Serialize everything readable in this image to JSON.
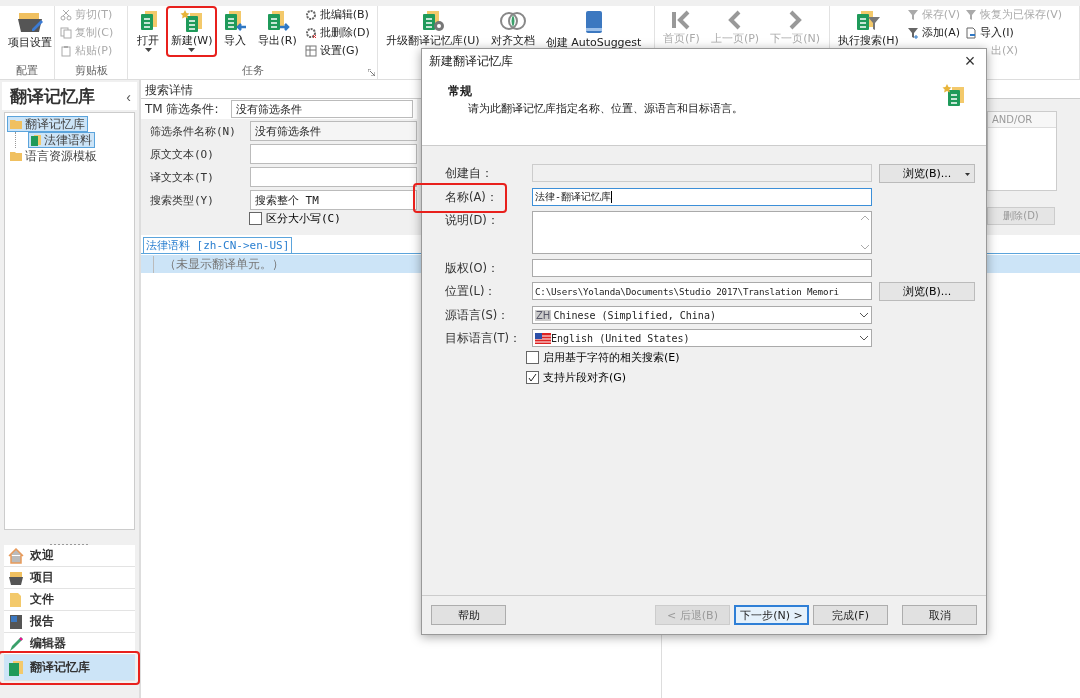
{
  "ribbon": {
    "groups": [
      {
        "label": "配置",
        "large": [
          {
            "label": "项目设置",
            "dropdown": false,
            "disabled": false,
            "highlighted": false
          }
        ]
      },
      {
        "label": "剪贴板",
        "columns": [
          [
            {
              "label": "剪切(T)",
              "disabled": true
            },
            {
              "label": "复制(C)",
              "disabled": true
            },
            {
              "label": "粘贴(P)",
              "disabled": true
            }
          ]
        ]
      },
      {
        "label": "任务",
        "launcher": true,
        "large": [
          {
            "label": "打开",
            "dropdown": true,
            "disabled": false,
            "highlighted": false
          },
          {
            "label": "新建(W)",
            "dropdown": true,
            "disabled": false,
            "highlighted": true
          },
          {
            "label": "导入",
            "dropdown": false,
            "disabled": false,
            "highlighted": false
          },
          {
            "label": "导出(R)",
            "dropdown": false,
            "disabled": false,
            "highlighted": false
          }
        ],
        "columns": [
          [
            {
              "label": "批编辑(B)",
              "disabled": false
            },
            {
              "label": "批删除(D)",
              "disabled": false
            },
            {
              "label": "设置(G)",
              "disabled": false
            }
          ]
        ]
      },
      {
        "large": [
          {
            "label": "升级翻译记忆库(U)",
            "dropdown": false,
            "disabled": false,
            "highlighted": false
          },
          {
            "label": "对齐文档",
            "dropdown": false,
            "disabled": false,
            "highlighted": false
          },
          {
            "label": "创建 AutoSuggest",
            "dropdown": false,
            "disabled": false,
            "highlighted": false
          }
        ]
      },
      {
        "large": [
          {
            "label": "首页(F)",
            "dropdown": false,
            "disabled": true,
            "highlighted": false
          },
          {
            "label": "上一页(P)",
            "dropdown": false,
            "disabled": true,
            "highlighted": false
          },
          {
            "label": "下一页(N)",
            "dropdown": false,
            "disabled": true,
            "highlighted": false
          }
        ]
      },
      {
        "large": [
          {
            "label": "执行搜索(H)",
            "dropdown": false,
            "disabled": false,
            "highlighted": false
          }
        ],
        "columns": [
          [
            {
              "label": "保存(V)",
              "disabled": true
            },
            {
              "label": "添加(A)",
              "disabled": false
            }
          ],
          [
            {
              "label": "恢复为已保存(V)",
              "disabled": true
            },
            {
              "label": "导入(I)",
              "disabled": false
            },
            {
              "label": "出(X)",
              "disabled": true
            }
          ]
        ]
      }
    ]
  },
  "sidebar": {
    "title": "翻译记忆库",
    "collapse": "‹",
    "tree": [
      {
        "label": "翻译记忆库",
        "selected": true,
        "children": [
          {
            "label": "法律语料",
            "selected": true
          }
        ]
      },
      {
        "label": "语言资源模板",
        "selected": false
      }
    ],
    "nav": [
      {
        "label": "欢迎",
        "selected": false,
        "highlighted": false
      },
      {
        "label": "项目",
        "selected": false,
        "highlighted": false
      },
      {
        "label": "文件",
        "selected": false,
        "highlighted": false
      },
      {
        "label": "报告",
        "selected": false,
        "highlighted": false
      },
      {
        "label": "编辑器",
        "selected": false,
        "highlighted": false
      },
      {
        "label": "翻译记忆库",
        "selected": true,
        "highlighted": true
      }
    ]
  },
  "search": {
    "header": "搜索详情",
    "filter_label": "TM 筛选条件:",
    "filter_value": "没有筛选条件",
    "fields": [
      {
        "label": "筛选条件名称(N)",
        "value": "没有筛选条件"
      },
      {
        "label": "原文文本(O)"
      },
      {
        "label": "译文文本(T)"
      },
      {
        "label": "搜索类型(Y)",
        "value": "搜索整个 TM"
      }
    ],
    "case_checkbox": {
      "label": "区分大小写(C)",
      "checked": false
    },
    "right_panel": {
      "column": "AND/OR",
      "button": "删除(D)"
    },
    "results_tab": "法律语料 [zh-CN->en-US]",
    "empty_message": "（未显示翻译单元。）"
  },
  "dialog": {
    "title": "新建翻译记忆库",
    "close": "×",
    "heading": "常规",
    "description": "请为此翻译记忆库指定名称、位置、源语言和目标语言。",
    "fields": [
      {
        "kind": "text",
        "label": "创建自：",
        "disabled": true,
        "button": "浏览(B)...",
        "button_dropdown": true
      },
      {
        "kind": "text",
        "label": "名称(A)：",
        "value": "法律-翻译记忆库",
        "focused": true,
        "highlighted": true
      },
      {
        "kind": "textarea",
        "label": "说明(D)："
      },
      {
        "kind": "text",
        "label": "版权(O)："
      },
      {
        "kind": "text",
        "label": "位置(L)：",
        "value": "C:\\Users\\Yolanda\\Documents\\Studio 2017\\Translation Memori",
        "button": "浏览(B)...",
        "button_dropdown": false
      },
      {
        "kind": "select-badge",
        "label": "源语言(S)：",
        "badge": "ZH",
        "value": "Chinese (Simplified, China)"
      },
      {
        "kind": "select-flag",
        "label": "目标语言(T)：",
        "value": "English (United States)"
      }
    ],
    "checkboxes": [
      {
        "label": "启用基于字符的相关搜索(E)",
        "checked": false
      },
      {
        "label": "支持片段对齐(G)",
        "checked": true
      }
    ],
    "buttons": [
      {
        "label": "帮助",
        "disabled": false,
        "default": false
      },
      {
        "label": "< 后退(B)",
        "disabled": true,
        "default": false
      },
      {
        "label": "下一步(N) >",
        "disabled": false,
        "default": true
      },
      {
        "label": "完成(F)",
        "disabled": false,
        "default": false
      },
      {
        "label": "取消",
        "disabled": false,
        "default": false
      }
    ]
  }
}
